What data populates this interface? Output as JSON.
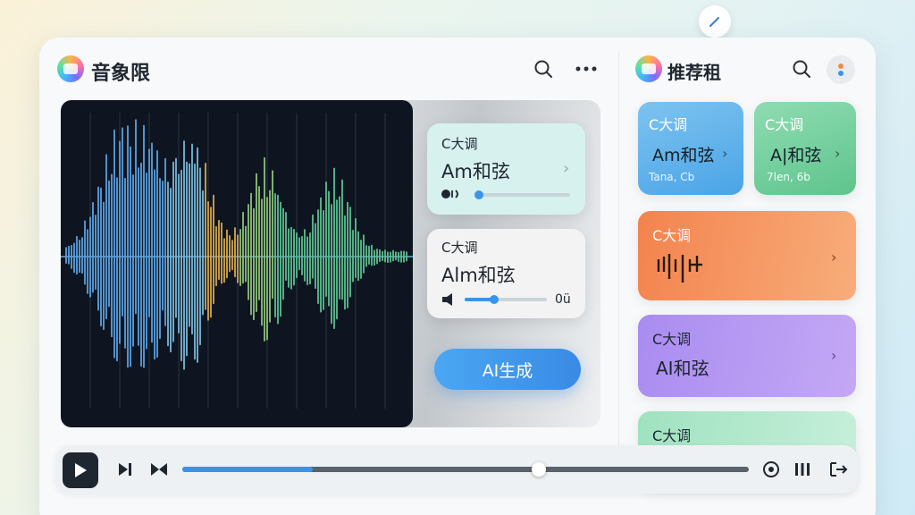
{
  "left_panel": {
    "title": "音象限",
    "chord_cards": [
      {
        "key": "C大调",
        "name": "Am和弦",
        "tail": "",
        "progress": 0.0
      },
      {
        "key": "C大调",
        "name": "Alm和弦",
        "tail": "0ü",
        "progress": 0.3
      }
    ],
    "ai_button_label": "AI生成"
  },
  "right_panel": {
    "title": "推荐租",
    "cards": [
      {
        "key": "C大调",
        "name": "Am和弦",
        "sub": "Tana, Cb",
        "color": "#5aaee8"
      },
      {
        "key": "C大调",
        "name": "A|和弦",
        "sub": "7len, 6b",
        "color": "#6ccf9d"
      },
      {
        "key": "C大调",
        "name": "",
        "sub": "",
        "color": "#f4925e"
      },
      {
        "key": "C大调",
        "name": "AI和弦",
        "sub": "",
        "color": "#b08cf0"
      },
      {
        "key": "C大调",
        "name": "",
        "sub": "",
        "color": "#8fdcb5"
      }
    ]
  },
  "player": {
    "progress": 0.63,
    "buffered": 0.23
  },
  "colors": {
    "accent": "#3b93e6",
    "wave_background": "#0e1521"
  }
}
